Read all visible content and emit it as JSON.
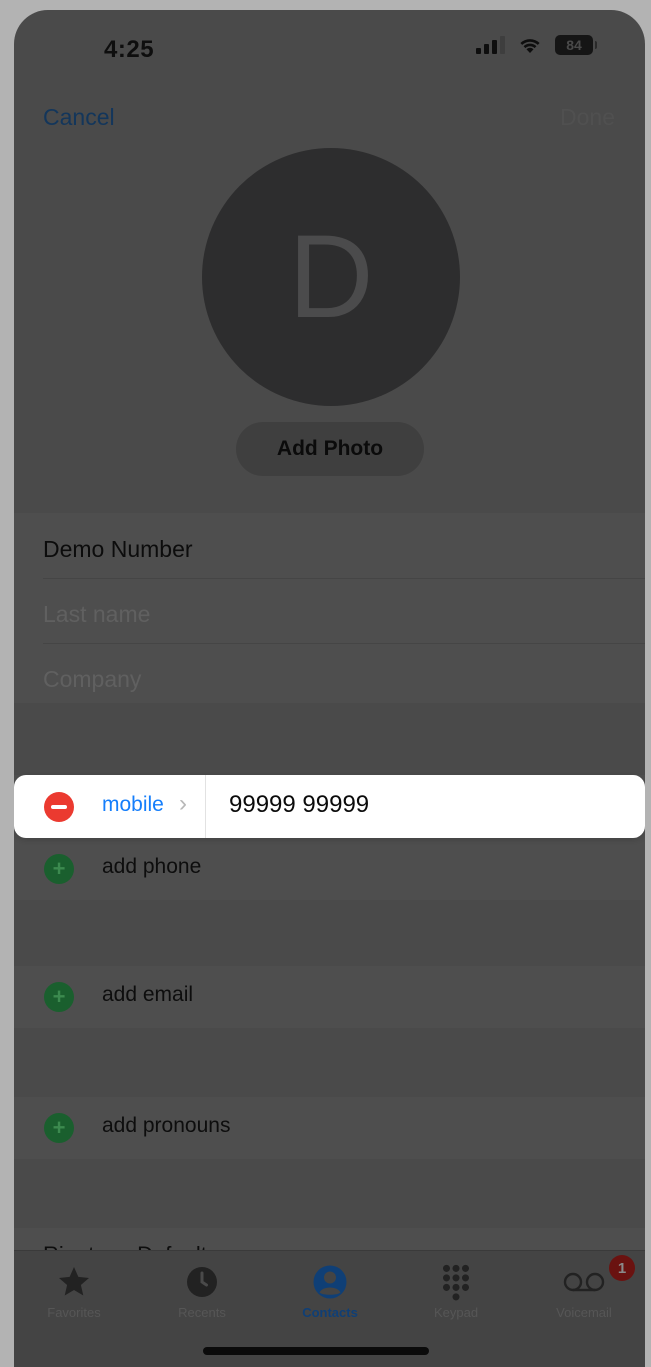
{
  "status_bar": {
    "time": "4:25",
    "battery": "84"
  },
  "nav": {
    "cancel": "Cancel",
    "done": "Done"
  },
  "avatar": {
    "initial": "D",
    "add_photo": "Add Photo"
  },
  "name_fields": {
    "first_name": "Demo Number",
    "last_name_placeholder": "Last name",
    "company_placeholder": "Company"
  },
  "phone": {
    "label": "mobile",
    "number": "99999 99999"
  },
  "add_rows": {
    "phone": "add phone",
    "email": "add email",
    "pronouns": "add pronouns"
  },
  "partial_row": "Ringtone Default",
  "tab_bar": {
    "favorites": "Favorites",
    "recents": "Recents",
    "contacts": "Contacts",
    "keypad": "Keypad",
    "voicemail": "Voicemail",
    "voicemail_badge": "1"
  },
  "colors": {
    "accent": "#157efb",
    "delete": "#eb3a30",
    "add": "#34c759",
    "dim_overlay": "#4a4a4a"
  }
}
